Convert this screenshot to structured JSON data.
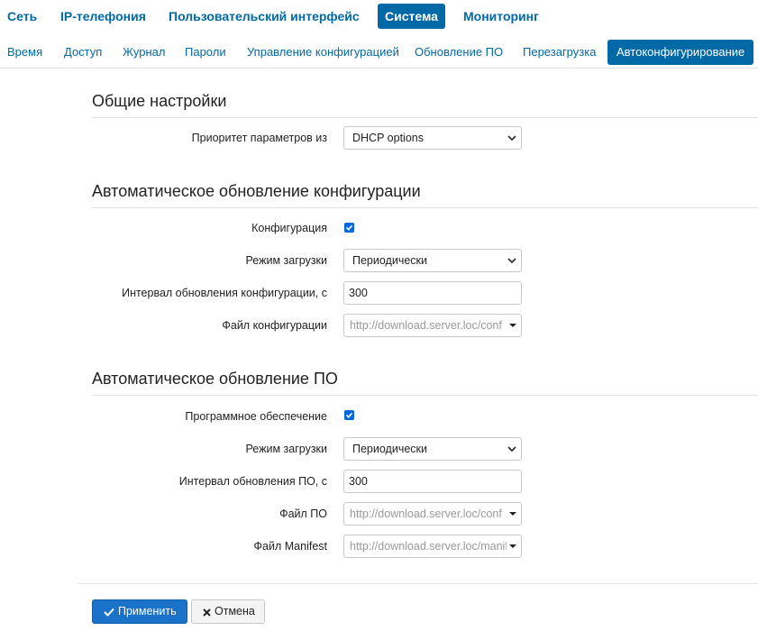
{
  "topnav": {
    "items": [
      "Сеть",
      "IP-телефония",
      "Пользовательский интерфейс",
      "Система",
      "Мониторинг"
    ],
    "active": "Система"
  },
  "subnav": {
    "items": [
      "Время",
      "Доступ",
      "Журнал",
      "Пароли",
      "Управление конфигурацией",
      "Обновление ПО",
      "Перезагрузка",
      "Автоконфигурирование"
    ],
    "active": "Автоконфигурирование"
  },
  "general": {
    "title": "Общие настройки",
    "priority_label": "Приоритет параметров из",
    "priority_value": "DHCP options"
  },
  "config_update": {
    "title": "Автоматическое обновление конфигурации",
    "enabled_label": "Конфигурация",
    "enabled": true,
    "mode_label": "Режим загрузки",
    "mode_value": "Периодически",
    "interval_label": "Интервал обновления конфигурации, с",
    "interval_value": "300",
    "file_label": "Файл конфигурации",
    "file_value": "http://download.server.loc/conf"
  },
  "firmware_update": {
    "title": "Автоматическое обновление ПО",
    "enabled_label": "Программное обеспечение",
    "enabled": true,
    "mode_label": "Режим загрузки",
    "mode_value": "Периодически",
    "interval_label": "Интервал обновления ПО, с",
    "interval_value": "300",
    "file_label": "Файл ПО",
    "file_value": "http://download.server.loc/conf",
    "manifest_label": "Файл Manifest",
    "manifest_value": "http://download.server.loc/manifest"
  },
  "actions": {
    "apply_label": "Применить",
    "cancel_label": "Отмена"
  },
  "colors": {
    "accent": "#0069a6",
    "primary_button": "#1a73c9",
    "checkbox": "#0069d9"
  },
  "icons": {
    "apply": "check-icon",
    "cancel": "times-icon",
    "select": "chevron-down-icon",
    "combo": "caret-down-icon"
  }
}
